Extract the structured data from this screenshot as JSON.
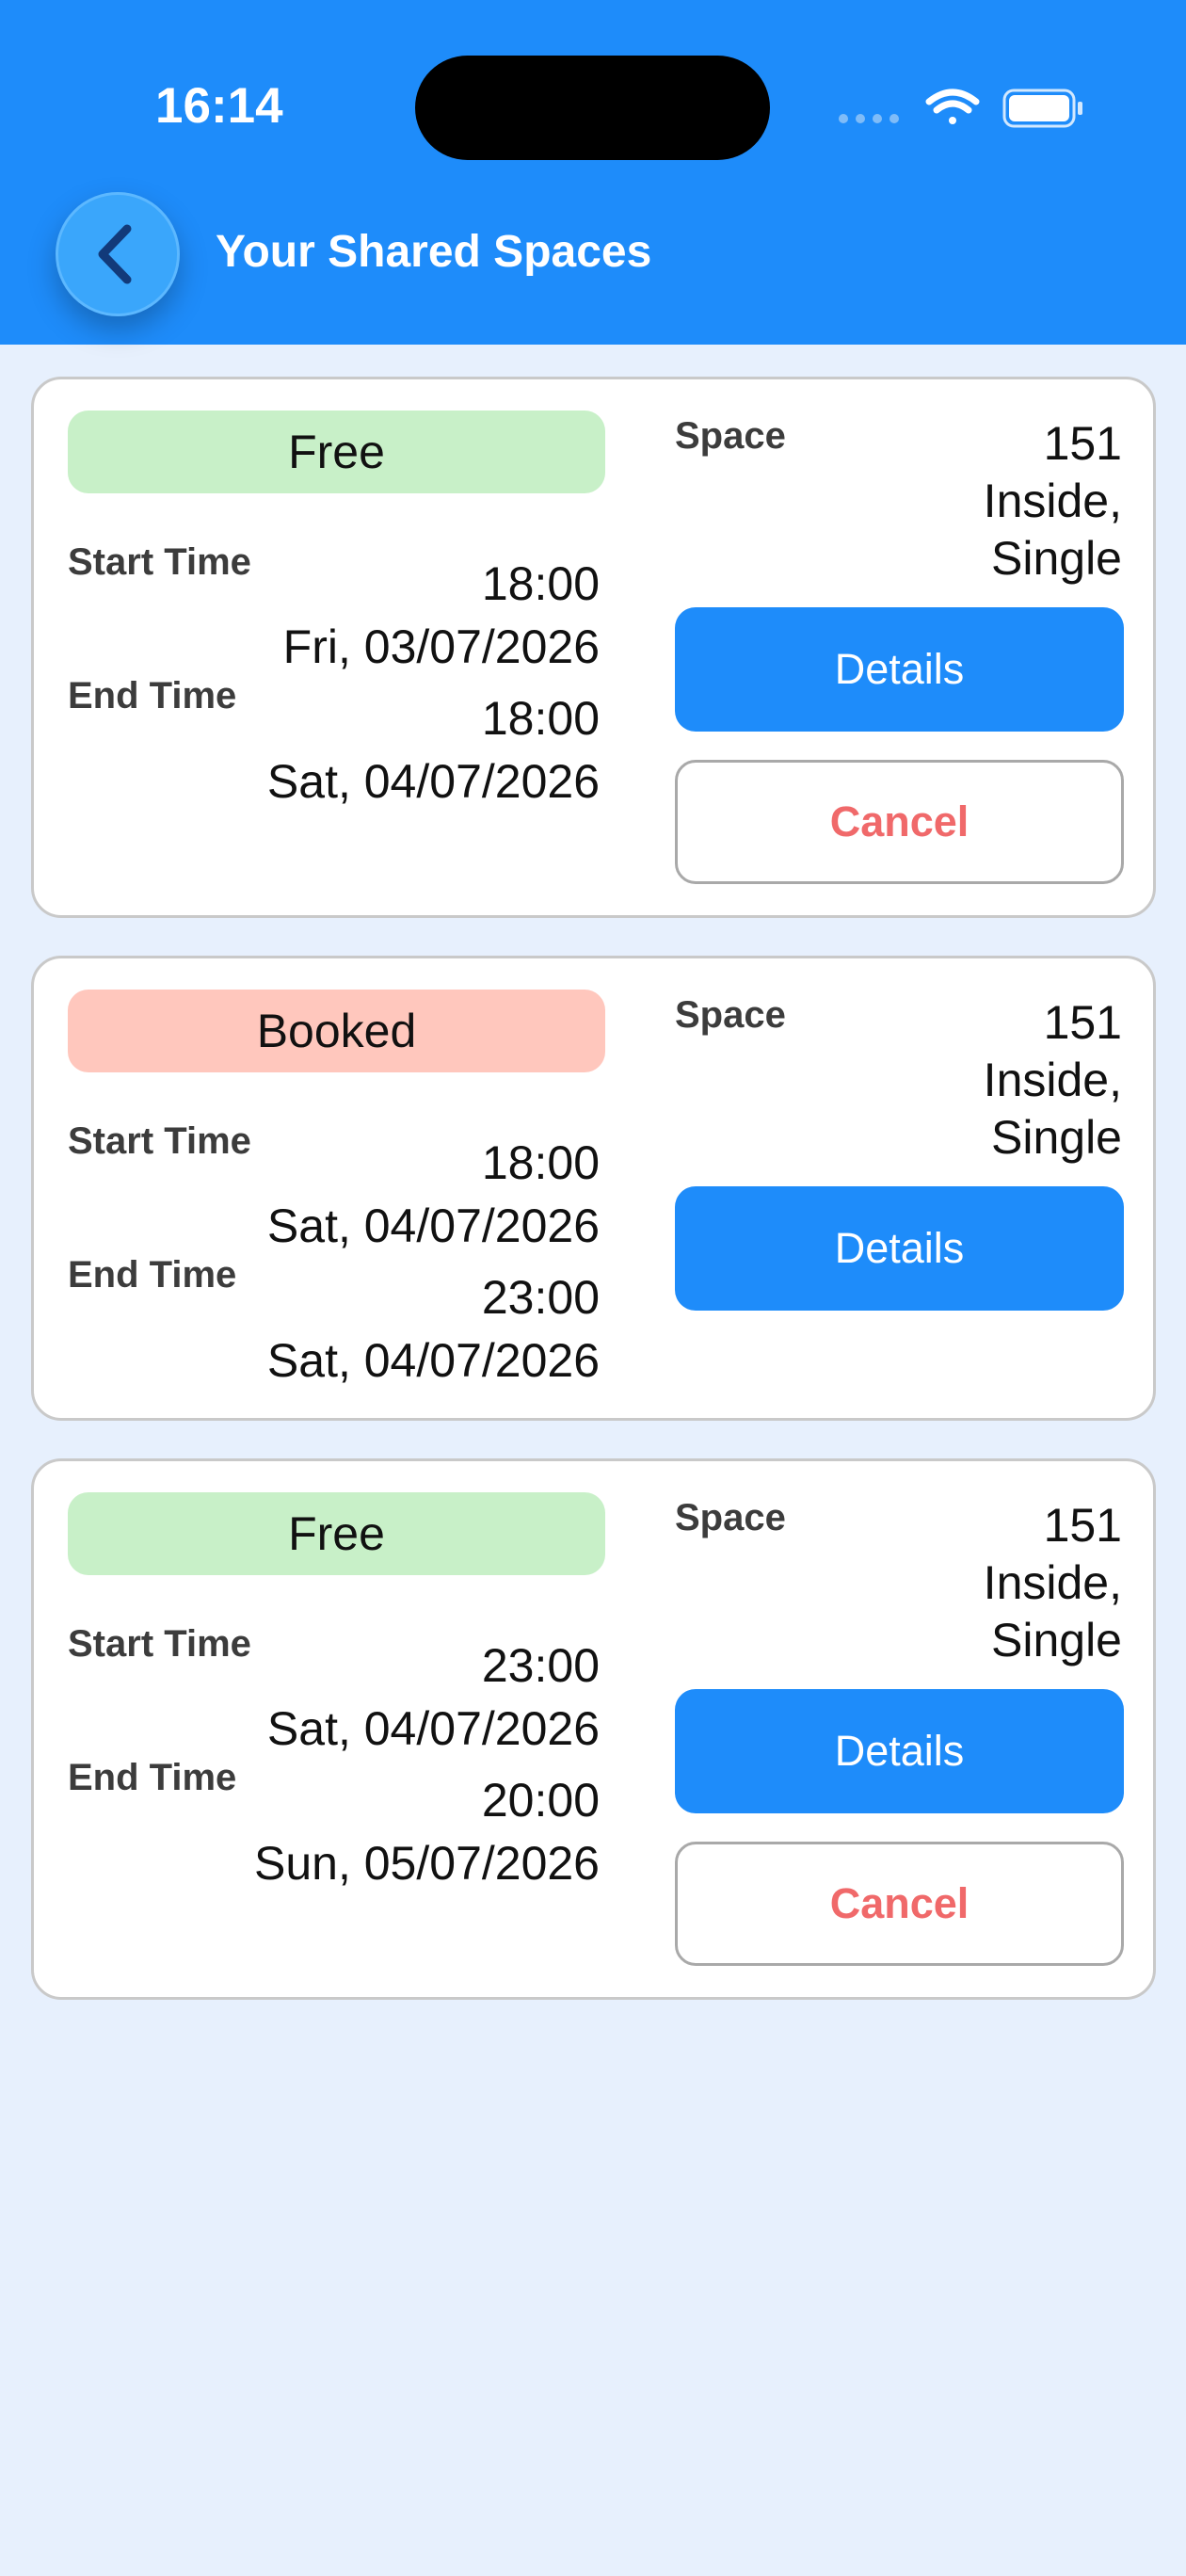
{
  "status_bar": {
    "time": "16:14"
  },
  "header": {
    "title": "Your Shared Spaces",
    "back_icon": "chevron-left-icon"
  },
  "labels": {
    "start_time": "Start Time",
    "end_time": "End Time",
    "space": "Space",
    "details": "Details",
    "cancel": "Cancel"
  },
  "colors": {
    "header": "#1e8cfa",
    "background": "#e7f0fd",
    "free": "#c8f0c8",
    "booked": "#ffc7bd",
    "cancel_text": "#f0696a"
  },
  "bookings": [
    {
      "status": "Free",
      "start_time": "18:00",
      "start_date": "Fri, 03/07/2026",
      "end_time": "18:00",
      "end_date": "Sat, 04/07/2026",
      "space_number": "151",
      "space_line2": "Inside,",
      "space_line3": "Single"
    },
    {
      "status": "Booked",
      "start_time": "18:00",
      "start_date": "Sat, 04/07/2026",
      "end_time": "23:00",
      "end_date": "Sat, 04/07/2026",
      "space_number": "151",
      "space_line2": "Inside,",
      "space_line3": "Single"
    },
    {
      "status": "Free",
      "start_time": "23:00",
      "start_date": "Sat, 04/07/2026",
      "end_time": "20:00",
      "end_date": "Sun, 05/07/2026",
      "space_number": "151",
      "space_line2": "Inside,",
      "space_line3": "Single"
    }
  ]
}
